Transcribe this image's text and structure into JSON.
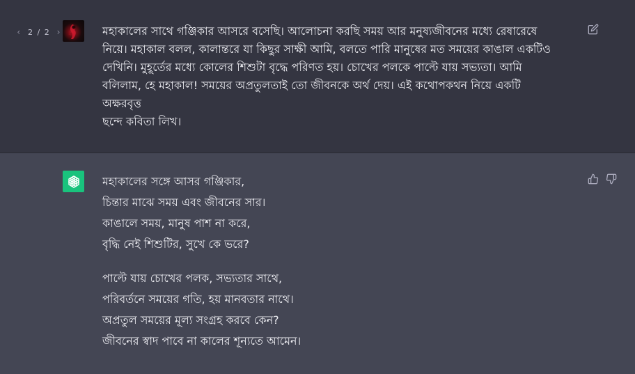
{
  "user_message": {
    "pager": {
      "current": "2",
      "separator": "/",
      "total": "2",
      "prev_icon": "chevron-left-icon",
      "next_icon": "chevron-right-icon"
    },
    "avatar": "user-avatar",
    "text": "মহাকালের সাথে গঞ্জিকার আসরে বসেছি। আলোচনা করছি সময় আর মনুষ্যজীবনের মধ্যে রেষারেষে নিয়ে। মহাকাল বলল, কালান্তরে যা কিছুর সাক্ষী আমি, বলতে পারি মানুষের মত সময়ের কাঙাল একটিও দেখিনি। মুহূর্তের মধ্যে কোলের শিশুটা বৃদ্ধে পরিণত হয়। চোখের পলকে পাল্টে যায় সভ্যতা। আমি বলিলাম,  হে মহাকাল! সময়ের অপ্রতুলতাই তো জীবনকে অর্থ দেয়। এই কথোপকথন নিয়ে একটি  অক্ষরবৃত্ত\n ছন্দে কবিতা লিখ।",
    "edit_icon": "edit-icon"
  },
  "assistant_message": {
    "avatar": "openai-logo-icon",
    "stanzas": [
      {
        "lines": [
          "মহাকালের সঙ্গে আসর গঞ্জিকার,",
          "চিন্তার মাঝে সময় এবং জীবনের সার।",
          "কাঙালে সময়, মানুষ পাশ না করে,",
          "বৃদ্ধি নেই শিশুটির, সুখে কে ভরে?"
        ]
      },
      {
        "lines": [
          "পাল্টে যায় চোখের পলক, সভ্যতার সাথে,",
          "পরিবর্তনে সময়ের গতি, হয় মানবতার নাথে।",
          "অপ্রতুল সময়ের মূল্য সংগ্রহ করবে কেন?",
          "জীবনের স্বাদ পাবে না কালের শূন্যতে আমেন।"
        ]
      }
    ],
    "thumbs_up_icon": "thumbs-up-icon",
    "thumbs_down_icon": "thumbs-down-icon"
  },
  "colors": {
    "user_bg": "#343541",
    "assistant_bg": "#444654",
    "text": "#ececf1",
    "icon": "#acacbe",
    "bot_avatar": "#19c37d"
  }
}
